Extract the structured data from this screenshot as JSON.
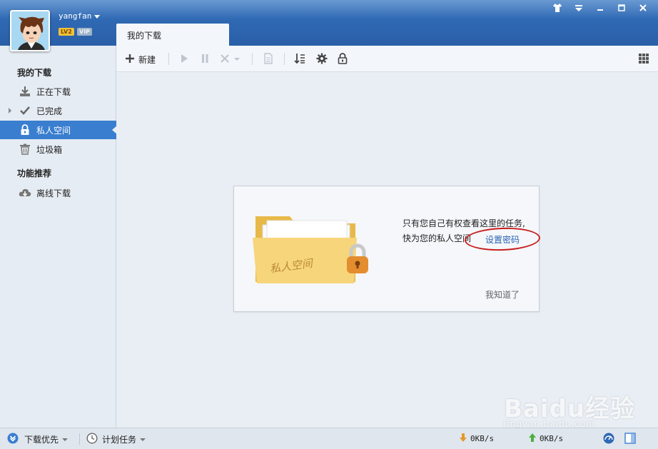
{
  "user": {
    "name": "yangfan",
    "level": "LV2",
    "vip": "VIP"
  },
  "tab": {
    "label": "我的下载"
  },
  "sidebar": {
    "section1": "我的下载",
    "items": [
      {
        "label": "正在下载",
        "icon": "download-icon"
      },
      {
        "label": "已完成",
        "icon": "check-icon"
      },
      {
        "label": "私人空间",
        "icon": "lock-icon"
      },
      {
        "label": "垃圾箱",
        "icon": "trash-icon"
      }
    ],
    "section2": "功能推荐",
    "items2": [
      {
        "label": "离线下载",
        "icon": "cloud-download-icon"
      }
    ]
  },
  "toolbar": {
    "new_label": "新建"
  },
  "card": {
    "line1": "只有您自己有权查看这里的任务,",
    "line2": "快为您的私人空间",
    "set_password": "设置密码",
    "got_it": "我知道了",
    "folder_text": "私人空间"
  },
  "statusbar": {
    "priority": "下载优先",
    "schedule": "计划任务",
    "down_speed": "0KB/s",
    "up_speed": "0KB/s"
  },
  "watermark": {
    "brand": "Baidu经验",
    "url": "jingyan.baidu.com"
  },
  "colors": {
    "accent": "#3a7ed0",
    "titlebar": "#2f69b3",
    "highlight_ring": "#c81e1e"
  }
}
